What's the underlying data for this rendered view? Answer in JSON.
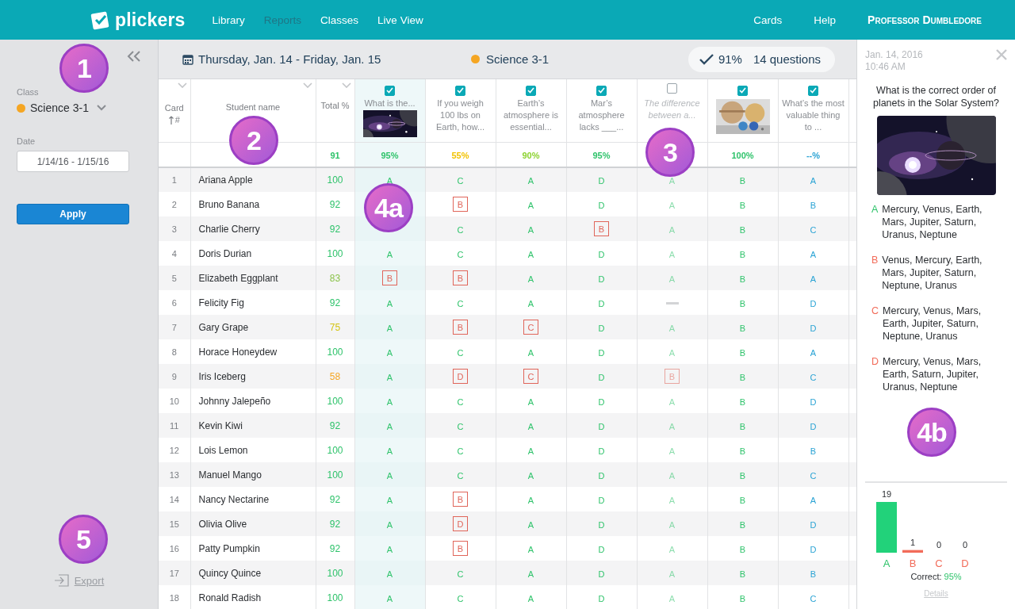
{
  "nav": {
    "logo": "plickers",
    "items": [
      {
        "label": "Library",
        "selected": false
      },
      {
        "label": "Reports",
        "selected": true
      },
      {
        "label": "Classes",
        "selected": false
      },
      {
        "label": "Live View",
        "selected": false
      }
    ],
    "right_items": [
      {
        "label": "Cards"
      },
      {
        "label": "Help"
      }
    ],
    "user": "Professor Dumbledore"
  },
  "sidebar": {
    "class_label": "Class",
    "class_name": "Science 3-1",
    "date_label": "Date",
    "date_value": "1/14/16 - 1/15/16",
    "apply": "Apply",
    "export": "Export"
  },
  "report_header": {
    "date_range": "Thursday, Jan. 14 - Friday, Jan. 15",
    "class_name": "Science 3-1",
    "score": "91%",
    "question_count": "14 questions"
  },
  "table": {
    "card_heading": "Card",
    "card_sort": "#",
    "name_heading": "Student name",
    "total_heading": "Total %",
    "total_score": "91",
    "questions": [
      {
        "kind": "text-picture",
        "label": "What is the...",
        "checked": true,
        "selected": true,
        "graded": true,
        "score": "95%",
        "color": "#2fc36b"
      },
      {
        "kind": "text",
        "label": "If you weigh 100 lbs on Earth, how...",
        "checked": true,
        "selected": false,
        "graded": true,
        "score": "55%",
        "color": "#f2c200"
      },
      {
        "kind": "text",
        "label": "Earth’s atmosphere is essential...",
        "checked": true,
        "selected": false,
        "graded": true,
        "score": "90%",
        "color": "#8bd22f"
      },
      {
        "kind": "text",
        "label": "Mar’s atmosphere lacks ___...",
        "checked": true,
        "selected": false,
        "graded": true,
        "score": "95%",
        "color": "#2fc36b"
      },
      {
        "kind": "text",
        "label": "The difference between a...",
        "checked": false,
        "selected": false,
        "graded": true
      },
      {
        "kind": "picture",
        "checked": true,
        "selected": false,
        "graded": true,
        "score": "100%",
        "color": "#2fc36b"
      },
      {
        "kind": "text",
        "label": "What’s the most valuable thing to ...",
        "checked": true,
        "selected": false,
        "graded": false,
        "score": "--%",
        "color": "#2aa3d4"
      }
    ],
    "rows": [
      {
        "card": "1",
        "name": "Ariana Apple",
        "total": "100",
        "color": "#2fc36b",
        "cells": [
          {
            "kind": "answer",
            "answer": "A",
            "correct": true
          },
          {
            "kind": "answer",
            "answer": "C",
            "correct": true
          },
          {
            "kind": "answer",
            "answer": "A",
            "correct": true
          },
          {
            "kind": "answer",
            "answer": "D",
            "correct": true
          },
          {
            "kind": "answer",
            "answer": "A",
            "correct": true
          },
          {
            "kind": "answer",
            "answer": "B",
            "correct": true
          },
          {
            "kind": "answer",
            "answer": "A"
          }
        ]
      },
      {
        "card": "2",
        "name": "Bruno Banana",
        "total": "92",
        "color": "#2fc36b",
        "cells": [
          {
            "kind": "covered"
          },
          {
            "kind": "answer",
            "answer": "B",
            "correct": false
          },
          {
            "kind": "answer",
            "answer": "A",
            "correct": true
          },
          {
            "kind": "answer",
            "answer": "D",
            "correct": true
          },
          {
            "kind": "answer",
            "answer": "A",
            "correct": true
          },
          {
            "kind": "answer",
            "answer": "B",
            "correct": true
          },
          {
            "kind": "answer",
            "answer": "B"
          }
        ]
      },
      {
        "card": "3",
        "name": "Charlie Cherry",
        "total": "92",
        "color": "#2fc36b",
        "cells": [
          {
            "kind": "covered"
          },
          {
            "kind": "answer",
            "answer": "C",
            "correct": true
          },
          {
            "kind": "answer",
            "answer": "A",
            "correct": true
          },
          {
            "kind": "answer",
            "answer": "B",
            "correct": false
          },
          {
            "kind": "answer",
            "answer": "A",
            "correct": true
          },
          {
            "kind": "answer",
            "answer": "B",
            "correct": true
          },
          {
            "kind": "answer",
            "answer": "C"
          }
        ]
      },
      {
        "card": "4",
        "name": "Doris Durian",
        "total": "100",
        "color": "#2fc36b",
        "cells": [
          {
            "kind": "answer",
            "answer": "A",
            "correct": true
          },
          {
            "kind": "answer",
            "answer": "C",
            "correct": true
          },
          {
            "kind": "answer",
            "answer": "A",
            "correct": true
          },
          {
            "kind": "answer",
            "answer": "D",
            "correct": true
          },
          {
            "kind": "answer",
            "answer": "A",
            "correct": true
          },
          {
            "kind": "answer",
            "answer": "B",
            "correct": true
          },
          {
            "kind": "answer",
            "answer": "A"
          }
        ]
      },
      {
        "card": "5",
        "name": "Elizabeth Eggplant",
        "total": "83",
        "color": "#8bc34a",
        "cells": [
          {
            "kind": "answer",
            "answer": "B",
            "correct": false
          },
          {
            "kind": "answer",
            "answer": "B",
            "correct": false
          },
          {
            "kind": "answer",
            "answer": "A",
            "correct": true
          },
          {
            "kind": "answer",
            "answer": "D",
            "correct": true
          },
          {
            "kind": "answer",
            "answer": "A",
            "correct": true
          },
          {
            "kind": "answer",
            "answer": "B",
            "correct": true
          },
          {
            "kind": "answer",
            "answer": "A"
          }
        ]
      },
      {
        "card": "6",
        "name": "Felicity Fig",
        "total": "92",
        "color": "#2fc36b",
        "cells": [
          {
            "kind": "answer",
            "answer": "A",
            "correct": true
          },
          {
            "kind": "answer",
            "answer": "C",
            "correct": true
          },
          {
            "kind": "answer",
            "answer": "A",
            "correct": true
          },
          {
            "kind": "answer",
            "answer": "D",
            "correct": true
          },
          {
            "kind": "no-answer"
          },
          {
            "kind": "answer",
            "answer": "B",
            "correct": true
          },
          {
            "kind": "answer",
            "answer": "D"
          }
        ]
      },
      {
        "card": "7",
        "name": "Gary Grape",
        "total": "75",
        "color": "#d4c414",
        "cells": [
          {
            "kind": "answer",
            "answer": "A",
            "correct": true
          },
          {
            "kind": "answer",
            "answer": "B",
            "correct": false
          },
          {
            "kind": "answer",
            "answer": "C",
            "correct": false
          },
          {
            "kind": "answer",
            "answer": "D",
            "correct": true
          },
          {
            "kind": "answer",
            "answer": "A",
            "correct": true
          },
          {
            "kind": "answer",
            "answer": "B",
            "correct": true
          },
          {
            "kind": "answer",
            "answer": "D"
          }
        ]
      },
      {
        "card": "8",
        "name": "Horace Honeydew",
        "total": "100",
        "color": "#2fc36b",
        "cells": [
          {
            "kind": "answer",
            "answer": "A",
            "correct": true
          },
          {
            "kind": "answer",
            "answer": "C",
            "correct": true
          },
          {
            "kind": "answer",
            "answer": "A",
            "correct": true
          },
          {
            "kind": "answer",
            "answer": "D",
            "correct": true
          },
          {
            "kind": "answer",
            "answer": "A",
            "correct": true
          },
          {
            "kind": "answer",
            "answer": "B",
            "correct": true
          },
          {
            "kind": "answer",
            "answer": "A"
          }
        ]
      },
      {
        "card": "9",
        "name": "Iris Iceberg",
        "total": "58",
        "color": "#f5a623",
        "cells": [
          {
            "kind": "answer",
            "answer": "A",
            "correct": true
          },
          {
            "kind": "answer",
            "answer": "D",
            "correct": false
          },
          {
            "kind": "answer",
            "answer": "C",
            "correct": false
          },
          {
            "kind": "answer",
            "answer": "D",
            "correct": true
          },
          {
            "kind": "answer",
            "answer": "B",
            "correct": false
          },
          {
            "kind": "answer",
            "answer": "B",
            "correct": true
          },
          {
            "kind": "answer",
            "answer": "C"
          }
        ]
      },
      {
        "card": "10",
        "name": "Johnny Jalepeño",
        "total": "100",
        "color": "#2fc36b",
        "cells": [
          {
            "kind": "answer",
            "answer": "A",
            "correct": true
          },
          {
            "kind": "answer",
            "answer": "C",
            "correct": true
          },
          {
            "kind": "answer",
            "answer": "A",
            "correct": true
          },
          {
            "kind": "answer",
            "answer": "D",
            "correct": true
          },
          {
            "kind": "answer",
            "answer": "A",
            "correct": true
          },
          {
            "kind": "answer",
            "answer": "B",
            "correct": true
          },
          {
            "kind": "answer",
            "answer": "D"
          }
        ]
      },
      {
        "card": "11",
        "name": "Kevin Kiwi",
        "total": "92",
        "color": "#2fc36b",
        "cells": [
          {
            "kind": "answer",
            "answer": "A",
            "correct": true
          },
          {
            "kind": "answer",
            "answer": "C",
            "correct": true
          },
          {
            "kind": "answer",
            "answer": "A",
            "correct": true
          },
          {
            "kind": "answer",
            "answer": "D",
            "correct": true
          },
          {
            "kind": "answer",
            "answer": "A",
            "correct": true
          },
          {
            "kind": "answer",
            "answer": "B",
            "correct": true
          },
          {
            "kind": "answer",
            "answer": "D"
          }
        ]
      },
      {
        "card": "12",
        "name": "Lois Lemon",
        "total": "100",
        "color": "#2fc36b",
        "cells": [
          {
            "kind": "answer",
            "answer": "A",
            "correct": true
          },
          {
            "kind": "answer",
            "answer": "C",
            "correct": true
          },
          {
            "kind": "answer",
            "answer": "A",
            "correct": true
          },
          {
            "kind": "answer",
            "answer": "D",
            "correct": true
          },
          {
            "kind": "answer",
            "answer": "A",
            "correct": true
          },
          {
            "kind": "answer",
            "answer": "B",
            "correct": true
          },
          {
            "kind": "answer",
            "answer": "B"
          }
        ]
      },
      {
        "card": "13",
        "name": "Manuel Mango",
        "total": "100",
        "color": "#2fc36b",
        "cells": [
          {
            "kind": "answer",
            "answer": "A",
            "correct": true
          },
          {
            "kind": "answer",
            "answer": "C",
            "correct": true
          },
          {
            "kind": "answer",
            "answer": "A",
            "correct": true
          },
          {
            "kind": "answer",
            "answer": "D",
            "correct": true
          },
          {
            "kind": "answer",
            "answer": "A",
            "correct": true
          },
          {
            "kind": "answer",
            "answer": "B",
            "correct": true
          },
          {
            "kind": "answer",
            "answer": "C"
          }
        ]
      },
      {
        "card": "14",
        "name": "Nancy Nectarine",
        "total": "92",
        "color": "#2fc36b",
        "cells": [
          {
            "kind": "answer",
            "answer": "A",
            "correct": true
          },
          {
            "kind": "answer",
            "answer": "B",
            "correct": false
          },
          {
            "kind": "answer",
            "answer": "A",
            "correct": true
          },
          {
            "kind": "answer",
            "answer": "D",
            "correct": true
          },
          {
            "kind": "answer",
            "answer": "A",
            "correct": true
          },
          {
            "kind": "answer",
            "answer": "B",
            "correct": true
          },
          {
            "kind": "answer",
            "answer": "A"
          }
        ]
      },
      {
        "card": "15",
        "name": "Olivia Olive",
        "total": "92",
        "color": "#2fc36b",
        "cells": [
          {
            "kind": "answer",
            "answer": "A",
            "correct": true
          },
          {
            "kind": "answer",
            "answer": "D",
            "correct": false
          },
          {
            "kind": "answer",
            "answer": "A",
            "correct": true
          },
          {
            "kind": "answer",
            "answer": "D",
            "correct": true
          },
          {
            "kind": "answer",
            "answer": "A",
            "correct": true
          },
          {
            "kind": "answer",
            "answer": "B",
            "correct": true
          },
          {
            "kind": "answer",
            "answer": "D"
          }
        ]
      },
      {
        "card": "16",
        "name": "Patty Pumpkin",
        "total": "92",
        "color": "#2fc36b",
        "cells": [
          {
            "kind": "answer",
            "answer": "A",
            "correct": true
          },
          {
            "kind": "answer",
            "answer": "B",
            "correct": false
          },
          {
            "kind": "answer",
            "answer": "A",
            "correct": true
          },
          {
            "kind": "answer",
            "answer": "D",
            "correct": true
          },
          {
            "kind": "answer",
            "answer": "A",
            "correct": true
          },
          {
            "kind": "answer",
            "answer": "B",
            "correct": true
          },
          {
            "kind": "answer",
            "answer": "D"
          }
        ]
      },
      {
        "card": "17",
        "name": "Quincy Quince",
        "total": "100",
        "color": "#2fc36b",
        "cells": [
          {
            "kind": "answer",
            "answer": "A",
            "correct": true
          },
          {
            "kind": "answer",
            "answer": "C",
            "correct": true
          },
          {
            "kind": "answer",
            "answer": "A",
            "correct": true
          },
          {
            "kind": "answer",
            "answer": "D",
            "correct": true
          },
          {
            "kind": "answer",
            "answer": "A",
            "correct": true
          },
          {
            "kind": "answer",
            "answer": "B",
            "correct": true
          },
          {
            "kind": "answer",
            "answer": "B"
          }
        ]
      },
      {
        "card": "18",
        "name": "Ronald Radish",
        "total": "100",
        "color": "#2fc36b",
        "cells": [
          {
            "kind": "answer",
            "answer": "A",
            "correct": true
          },
          {
            "kind": "answer",
            "answer": "C",
            "correct": true
          },
          {
            "kind": "answer",
            "answer": "A",
            "correct": true
          },
          {
            "kind": "answer",
            "answer": "D",
            "correct": true
          },
          {
            "kind": "answer",
            "answer": "A",
            "correct": true
          },
          {
            "kind": "answer",
            "answer": "B",
            "correct": true
          },
          {
            "kind": "answer",
            "answer": "C"
          }
        ]
      }
    ]
  },
  "detail_panel": {
    "date": "Jan. 14, 2016",
    "time": "10:46 AM",
    "question": "What is the correct order of planets in the Solar System?",
    "choices": [
      {
        "letter": "A",
        "text": "Mercury, Venus, Earth, Mars, Jupiter, Saturn, Uranus, Neptune",
        "correct": true
      },
      {
        "letter": "B",
        "text": "Venus, Mercury, Earth, Mars, Jupiter, Saturn, Neptune, Uranus",
        "correct": false
      },
      {
        "letter": "C",
        "text": "Mercury, Venus, Mars, Earth, Jupiter, Saturn, Neptune, Uranus",
        "correct": false
      },
      {
        "letter": "D",
        "text": "Mercury, Venus, Mars, Earth, Saturn, Jupiter, Uranus, Neptune",
        "correct": false
      }
    ],
    "chart_data": {
      "type": "bar",
      "categories": [
        "A",
        "B",
        "C",
        "D"
      ],
      "values": [
        19,
        1,
        0,
        0
      ],
      "data_labels": true
    },
    "correct_label": "Correct:",
    "correct_value": "95%",
    "details": "Details"
  },
  "callouts": [
    {
      "label": "1"
    },
    {
      "label": "2"
    },
    {
      "label": "3"
    },
    {
      "label": "4a"
    },
    {
      "label": "4b"
    },
    {
      "label": "5"
    }
  ]
}
